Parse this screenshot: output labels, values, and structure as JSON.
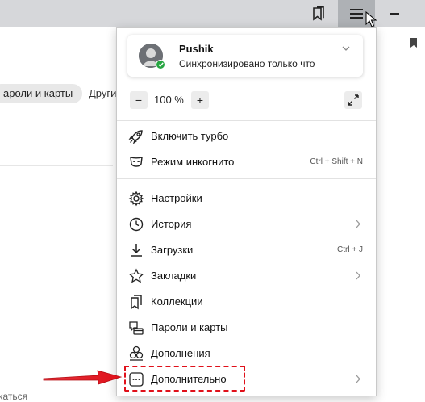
{
  "background": {
    "tab_passwords": "ароли и карты",
    "tab_other": "Други",
    "bottom_text": "каться"
  },
  "menu": {
    "profile": {
      "name": "Pushik",
      "status": "Синхронизировано только что"
    },
    "zoom": {
      "minus": "−",
      "value": "100 %",
      "plus": "+"
    },
    "items": [
      {
        "label": "Включить турбо",
        "icon": "rocket-icon",
        "shortcut": "",
        "submenu": false
      },
      {
        "label": "Режим инкогнито",
        "icon": "incognito-mask-icon",
        "shortcut": "Ctrl + Shift + N",
        "submenu": false
      },
      {
        "label": "Настройки",
        "icon": "gear-icon",
        "shortcut": "",
        "submenu": false
      },
      {
        "label": "История",
        "icon": "history-clock-icon",
        "shortcut": "",
        "submenu": true
      },
      {
        "label": "Загрузки",
        "icon": "download-icon",
        "shortcut": "Ctrl + J",
        "submenu": false
      },
      {
        "label": "Закладки",
        "icon": "star-icon",
        "shortcut": "",
        "submenu": true
      },
      {
        "label": "Коллекции",
        "icon": "collections-bookmark-icon",
        "shortcut": "",
        "submenu": false
      },
      {
        "label": "Пароли и карты",
        "icon": "key-card-icon",
        "shortcut": "",
        "submenu": false
      },
      {
        "label": "Дополнения",
        "icon": "puzzle-icon",
        "shortcut": "",
        "submenu": false
      },
      {
        "label": "Дополнительно",
        "icon": "more-dots-icon",
        "shortcut": "",
        "submenu": true
      }
    ]
  },
  "colors": {
    "titlebar": "#d6d7da",
    "menu_button_active": "#aeb1b5",
    "sync_badge": "#26a541",
    "annotation_red": "#e0101a"
  }
}
